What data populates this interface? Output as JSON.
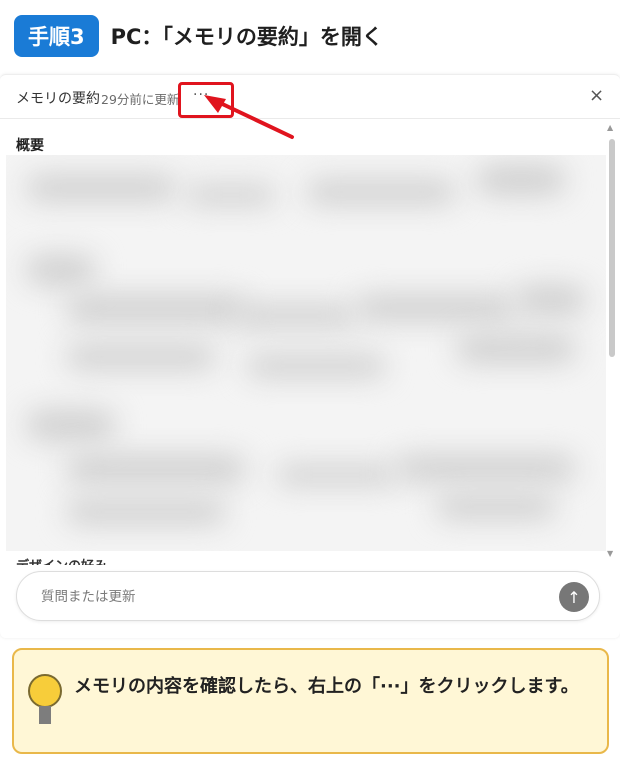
{
  "step": {
    "badge": "手順3",
    "title": "PC：「メモリの要約」を開く"
  },
  "panel": {
    "title": "メモリの要約",
    "updated": "29分前に更新",
    "more_label": "···",
    "close_label": "×",
    "section_title": "概要",
    "next_section_title": "デザインの好み",
    "input_placeholder": "質問または更新",
    "send_label": "↑"
  },
  "note": {
    "text": "メモリの内容を確認したら、右上の「···」をクリックします。"
  },
  "colors": {
    "badge": "#1a7bd6",
    "highlight": "#e0141e",
    "note_bg": "#fff7d6",
    "note_border": "#e9b84a"
  },
  "icons": {
    "close": "close-icon",
    "send": "arrow-up-icon",
    "bulb": "lightbulb-icon",
    "annotation": "red-arrow-icon"
  }
}
